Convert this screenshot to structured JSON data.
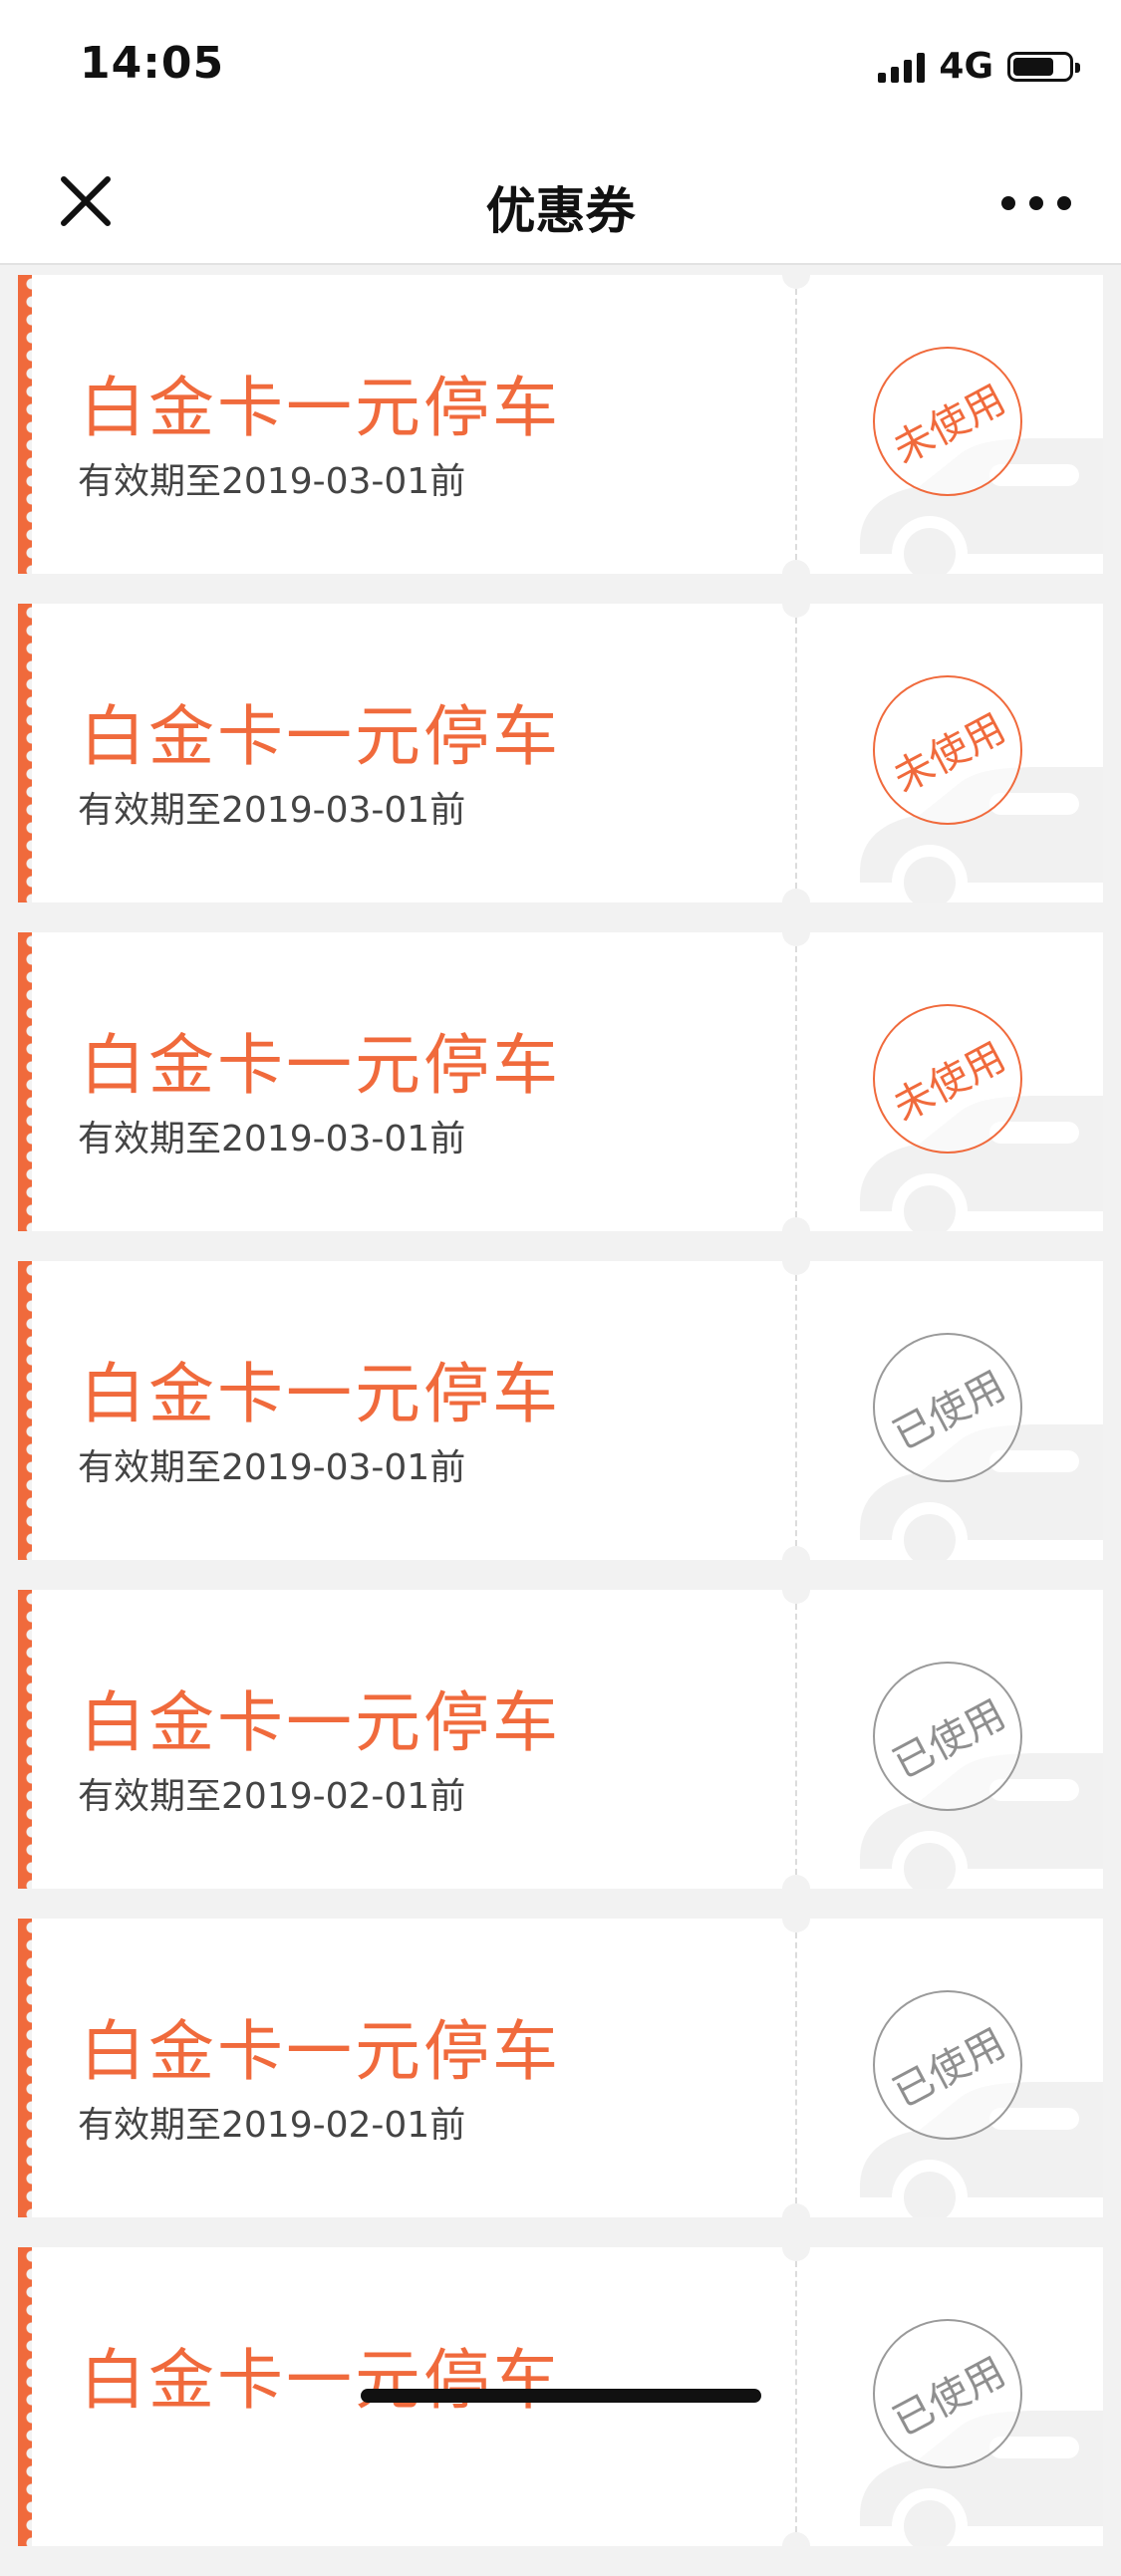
{
  "status_bar": {
    "time": "14:05",
    "network": "4G"
  },
  "nav": {
    "title": "优惠券"
  },
  "coupons": [
    {
      "title": "白金卡一元停车",
      "validity": "有效期至2019-03-01前",
      "status": "未使用",
      "used": false
    },
    {
      "title": "白金卡一元停车",
      "validity": "有效期至2019-03-01前",
      "status": "未使用",
      "used": false
    },
    {
      "title": "白金卡一元停车",
      "validity": "有效期至2019-03-01前",
      "status": "未使用",
      "used": false
    },
    {
      "title": "白金卡一元停车",
      "validity": "有效期至2019-03-01前",
      "status": "已使用",
      "used": true
    },
    {
      "title": "白金卡一元停车",
      "validity": "有效期至2019-02-01前",
      "status": "已使用",
      "used": true
    },
    {
      "title": "白金卡一元停车",
      "validity": "有效期至2019-02-01前",
      "status": "已使用",
      "used": true
    },
    {
      "title": "白金卡一元停车",
      "validity": "",
      "status": "已使用",
      "used": true
    }
  ],
  "colors": {
    "accent": "#f06a3c",
    "used_stamp": "#8f8f8f",
    "background": "#f2f2f2"
  }
}
